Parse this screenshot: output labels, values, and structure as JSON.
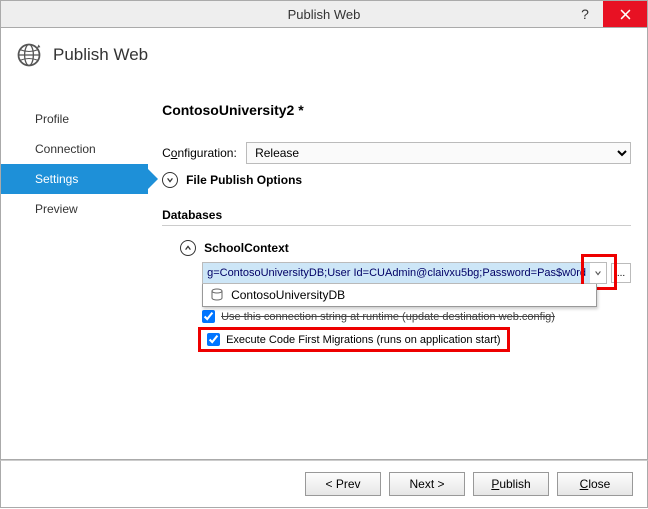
{
  "window": {
    "title": "Publish Web"
  },
  "header": {
    "title": "Publish Web"
  },
  "sidebar": {
    "items": [
      {
        "label": "Profile"
      },
      {
        "label": "Connection"
      },
      {
        "label": "Settings"
      },
      {
        "label": "Preview"
      }
    ]
  },
  "main": {
    "project": "ContosoUniversity2 *",
    "config_label_pre": "C",
    "config_label_u": "o",
    "config_label_post": "nfiguration:",
    "config_value": "Release",
    "fpo_label": "File Publish Options",
    "db_section": "Databases",
    "context_name": "SchoolContext",
    "conn_string": "g=ContosoUniversityDB;User Id=CUAdmin@claivxu5bg;Password=Pas$w0rd",
    "conn_dropdown_item": "ContosoUniversityDB",
    "chk_runtime": "Use this connection string at runtime (update destination web.config)",
    "chk_migrations": "Execute Code First Migrations (runs on application start)"
  },
  "footer": {
    "prev": "< Prev",
    "next": "Next >",
    "publish": "Publish",
    "close": "Close"
  }
}
